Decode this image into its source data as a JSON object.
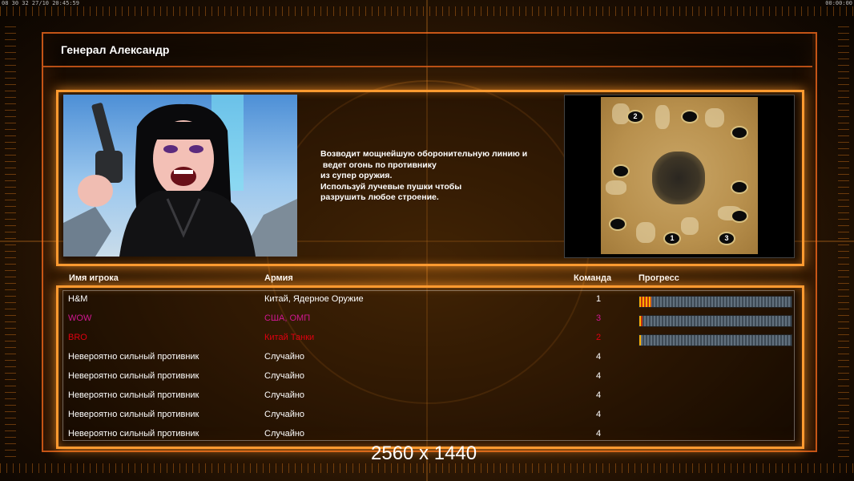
{
  "system_bar": {
    "left": "08 30 32 27/10 20:45:59",
    "right": "00:00:00"
  },
  "general_title": "Генерал Александр",
  "description_lines": [
    "Возводит мощнейшую оборонительную линию и",
    " ведет огонь по противнику",
    "из супер оружия.",
    "Используй лучевые пушки чтобы",
    "разрушить любое строение."
  ],
  "map": {
    "slots": [
      "2",
      "",
      "",
      "",
      "",
      "",
      "",
      "1",
      "3"
    ]
  },
  "columns": {
    "name": "Имя игрока",
    "army": "Армия",
    "team": "Команда",
    "progress": "Прогресс"
  },
  "players": [
    {
      "name": "H&M",
      "army": "Китай, Ядерное Оружие",
      "team": "1",
      "color": "#ffffff",
      "progress": 0.08
    },
    {
      "name": "WOW",
      "army": "США, ОМП",
      "team": "3",
      "color": "#d01890",
      "progress": 0.02
    },
    {
      "name": "BRO",
      "army": "Китай Танки",
      "team": "2",
      "color": "#e00010",
      "progress": 0.01
    },
    {
      "name": "Невероятно сильный противник",
      "army": "Случайно",
      "team": "4",
      "color": "#ffffff",
      "progress": null
    },
    {
      "name": "Невероятно сильный противник",
      "army": "Случайно",
      "team": "4",
      "color": "#ffffff",
      "progress": null
    },
    {
      "name": "Невероятно сильный противник",
      "army": "Случайно",
      "team": "4",
      "color": "#ffffff",
      "progress": null
    },
    {
      "name": "Невероятно сильный противник",
      "army": "Случайно",
      "team": "4",
      "color": "#ffffff",
      "progress": null
    },
    {
      "name": "Невероятно сильный противник",
      "army": "Случайно",
      "team": "4",
      "color": "#ffffff",
      "progress": null
    }
  ],
  "resolution_label": "2560 x 1440"
}
